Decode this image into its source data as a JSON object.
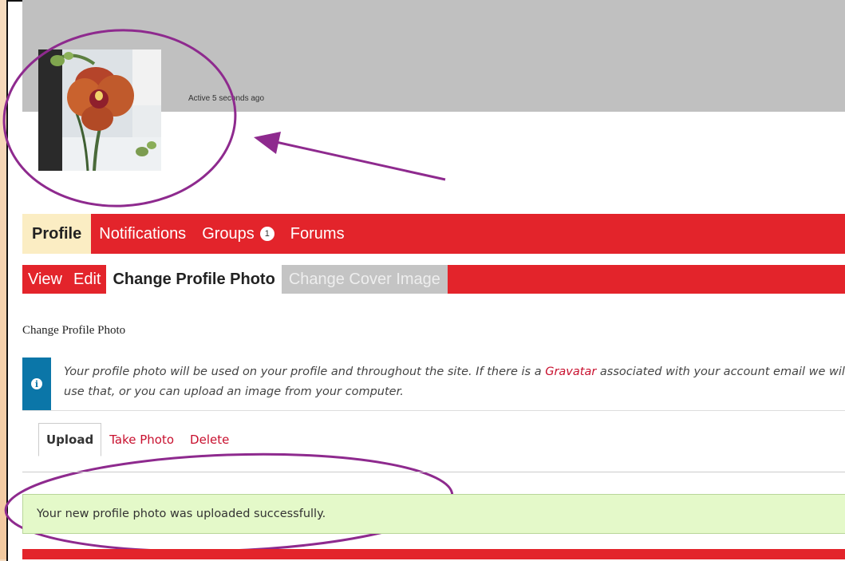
{
  "profile": {
    "activity": "Active 5 seconds ago",
    "avatar": "orchid-photo"
  },
  "nav": {
    "primary": [
      {
        "label": "Profile",
        "active": true
      },
      {
        "label": "Notifications"
      },
      {
        "label": "Groups",
        "badge": "1"
      },
      {
        "label": "Forums"
      }
    ],
    "secondary": [
      {
        "label": "View"
      },
      {
        "label": "Edit"
      },
      {
        "label": "Change Profile Photo",
        "current": true
      },
      {
        "label": "Change Cover Image",
        "disabled": true
      }
    ]
  },
  "main": {
    "heading": "Change Profile Photo",
    "notice": {
      "icon": "info-icon",
      "text_before": "Your profile photo will be used on your profile and throughout the site. If there is a ",
      "link": "Gravatar",
      "text_after": " associated with your account email we will use that, or you can upload an image from your computer."
    },
    "tabs": [
      "Upload",
      "Take Photo",
      "Delete"
    ],
    "success": "Your new profile photo was uploaded successfully."
  },
  "colors": {
    "brand_red": "#e3242b",
    "info_blue": "#0b76a8",
    "success_bg": "#e4f9c9",
    "annotation_purple": "#8e2a8e"
  }
}
